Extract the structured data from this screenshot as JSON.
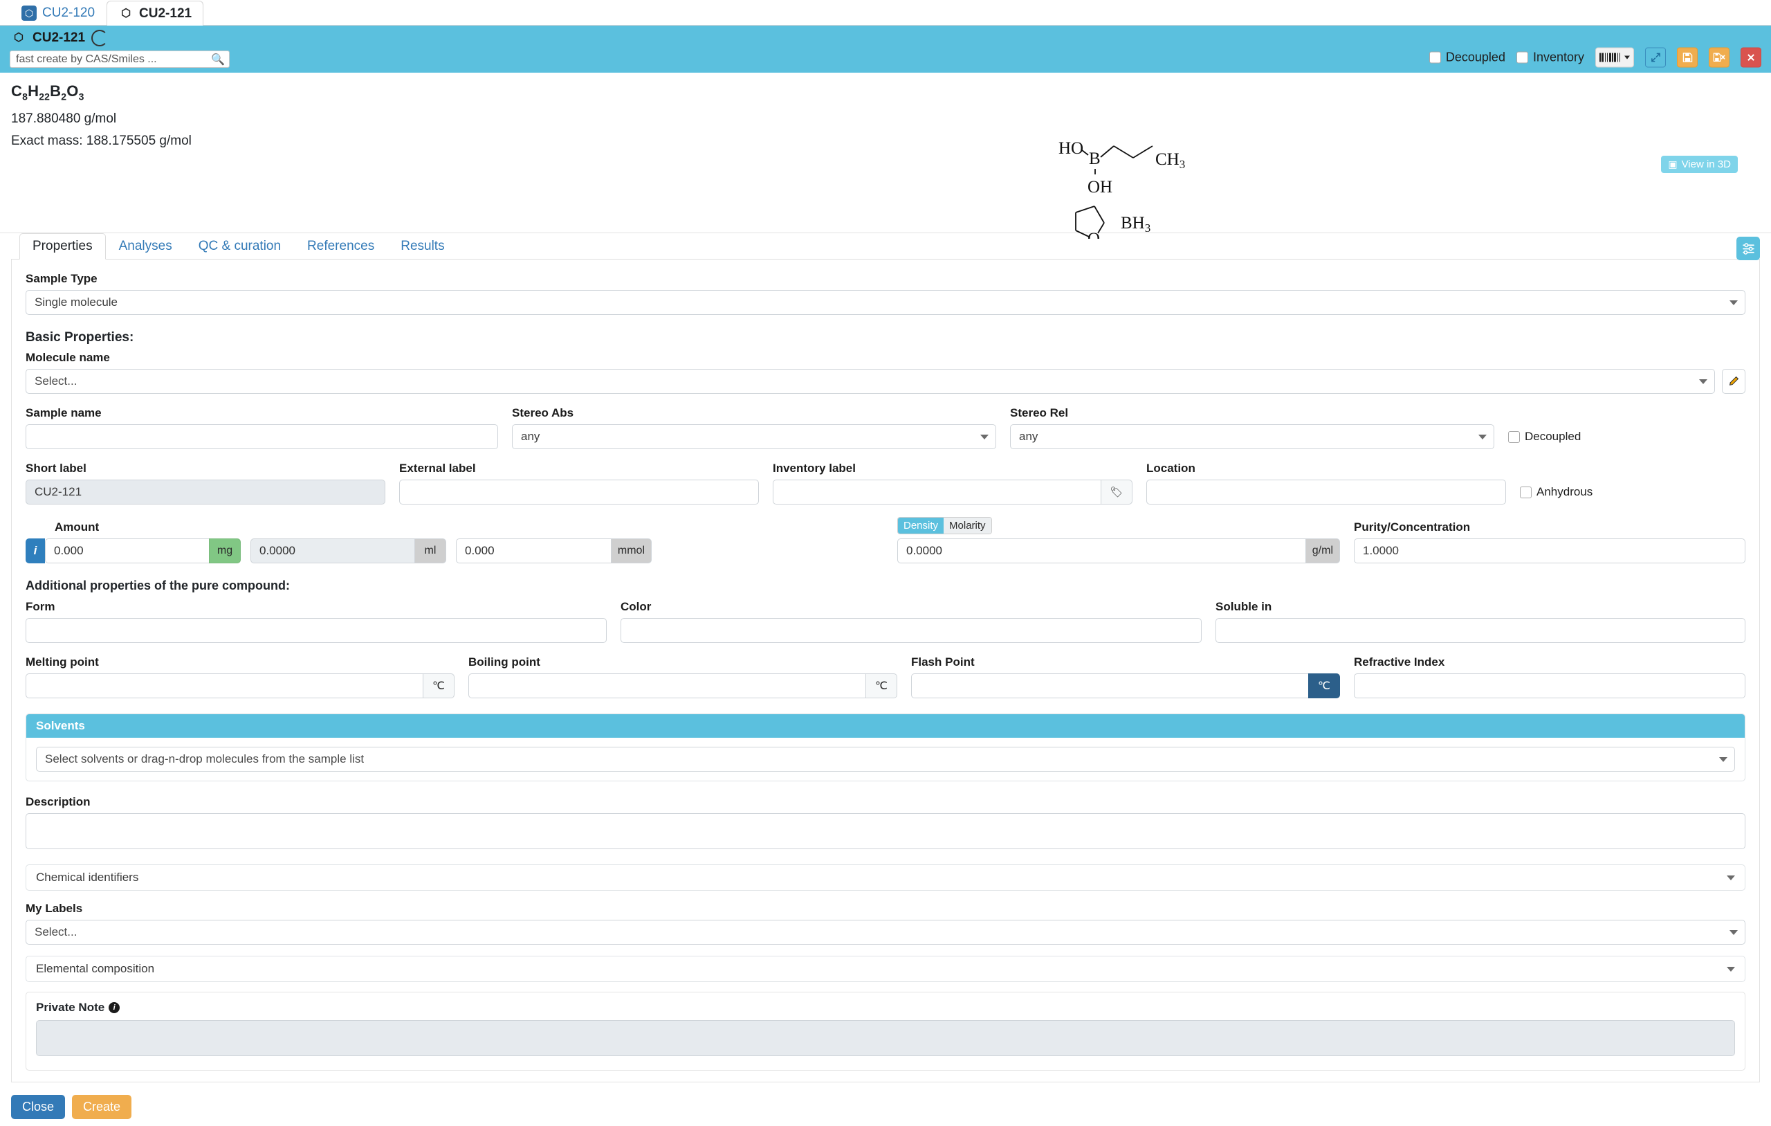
{
  "browser_tabs": [
    {
      "label": "CU2-120",
      "active": false,
      "icon": "hexagon-icon"
    },
    {
      "label": "CU2-121",
      "active": true,
      "icon": "hexagon-icon"
    }
  ],
  "header": {
    "title": "CU2-121",
    "spinner_icon": "loading-ring-icon",
    "search": {
      "value": "",
      "placeholder": "fast create by CAS/Smiles ...",
      "icon": "search-icon"
    },
    "decoupled_label": "Decoupled",
    "decoupled_checked": false,
    "inventory_label": "Inventory",
    "inventory_checked": false,
    "buttons": [
      {
        "name": "barcode-dropdown-button",
        "icon": "barcode-icon"
      },
      {
        "name": "expand-button",
        "icon": "expand-arrows-icon"
      },
      {
        "name": "save-button",
        "icon": "floppy-disk-icon"
      },
      {
        "name": "save-and-close-button",
        "icon": "floppy-disk-x-icon"
      },
      {
        "name": "close-button",
        "icon": "close-x-icon"
      }
    ],
    "accent_color": "#5bc0de"
  },
  "molecule": {
    "formula_parts": [
      {
        "t": "C",
        "sub": false
      },
      {
        "t": "8",
        "sub": true
      },
      {
        "t": "H",
        "sub": false
      },
      {
        "t": "22",
        "sub": true
      },
      {
        "t": "B",
        "sub": false
      },
      {
        "t": "2",
        "sub": true
      },
      {
        "t": "O",
        "sub": false
      },
      {
        "t": "3",
        "sub": true
      }
    ],
    "formula_text": "C8H22B2O3",
    "molecular_weight": "187.880480 g/mol",
    "exact_mass": "Exact mass: 188.175505 g/mol",
    "view_3d_label": "View in 3D",
    "view_3d_icon": "cube-icon",
    "structure_labels": {
      "ho": "HO",
      "b": "B",
      "oh": "OH",
      "ch3_c": "CH",
      "ch3_sub": "3",
      "o": "O",
      "bh3_b": "BH",
      "bh3_sub": "3"
    }
  },
  "tabs": [
    {
      "label": "Properties",
      "active": true
    },
    {
      "label": "Analyses",
      "active": false
    },
    {
      "label": "QC & curation",
      "active": false
    },
    {
      "label": "References",
      "active": false
    },
    {
      "label": "Results",
      "active": false
    }
  ],
  "settings_button_icon": "sliders-icon",
  "form": {
    "sample_type_label": "Sample Type",
    "sample_type_value": "Single molecule",
    "basic_properties_heading": "Basic Properties:",
    "molecule_name_label": "Molecule name",
    "molecule_name_value": "Select...",
    "molecule_name_edit_icon": "pencil-icon",
    "sample_name_label": "Sample name",
    "sample_name_value": "",
    "stereo_abs_label": "Stereo Abs",
    "stereo_abs_value": "any",
    "stereo_rel_label": "Stereo Rel",
    "stereo_rel_value": "any",
    "decoupled_label": "Decoupled",
    "short_label_label": "Short label",
    "short_label_value": "CU2-121",
    "external_label_label": "External label",
    "external_label_value": "",
    "inventory_label_label": "Inventory label",
    "inventory_label_value": "",
    "inventory_tag_icon": "tag-icon",
    "location_label": "Location",
    "location_value": "",
    "anhydrous_label": "Anhydrous",
    "amount_label": "Amount",
    "amount_info_icon": "info-icon",
    "amount_mass_value": "0.000",
    "amount_mass_unit": "mg",
    "amount_volume_value": "0.0000",
    "amount_volume_unit": "ml",
    "amount_mol_value": "0.000",
    "amount_mol_unit": "mmol",
    "density_label": "Density",
    "molarity_label": "Molarity",
    "density_active": true,
    "density_value": "0.0000",
    "density_unit": "g/ml",
    "purity_label": "Purity/Concentration",
    "purity_value": "1.0000",
    "additional_heading": "Additional properties of the pure compound:",
    "form_label": "Form",
    "form_value": "",
    "color_label": "Color",
    "color_value": "",
    "soluble_in_label": "Soluble in",
    "soluble_in_value": "",
    "melting_point_label": "Melting point",
    "melting_point_value": "",
    "melting_point_unit": "℃",
    "boiling_point_label": "Boiling point",
    "boiling_point_value": "",
    "boiling_point_unit": "℃",
    "flash_point_label": "Flash Point",
    "flash_point_value": "",
    "flash_point_unit": "℃",
    "refractive_index_label": "Refractive Index",
    "refractive_index_value": "",
    "solvents_header": "Solvents",
    "solvents_placeholder": "Select solvents or drag-n-drop molecules from the sample list",
    "description_label": "Description",
    "description_value": "",
    "chemical_identifiers_label": "Chemical identifiers",
    "my_labels_label": "My Labels",
    "my_labels_value": "Select...",
    "elemental_composition_label": "Elemental composition",
    "private_note_label": "Private Note",
    "private_note_info_icon": "info-icon",
    "private_note_value": ""
  },
  "footer": {
    "close_label": "Close",
    "create_label": "Create"
  }
}
